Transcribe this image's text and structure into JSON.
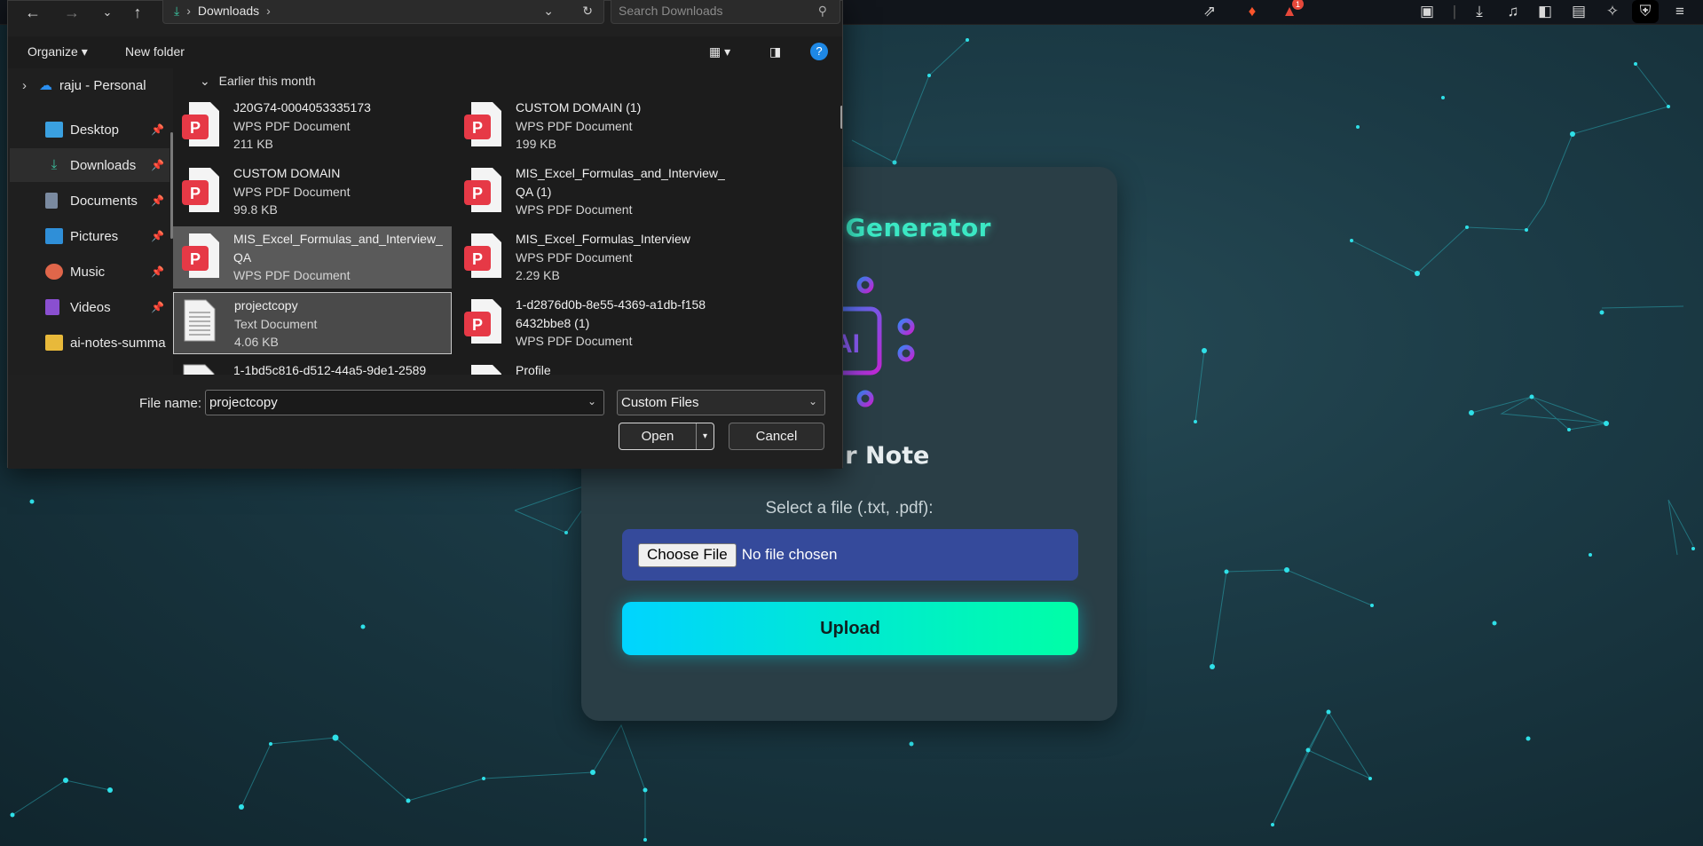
{
  "colors": {
    "accent_teal": "#3be8c4",
    "file_input_bg": "#354a9b",
    "upload_gradient_start": "#00d4ff",
    "upload_gradient_end": "#00ffa6",
    "card_bg": "#2a3e46",
    "pdf_red": "#e63946"
  },
  "webpage": {
    "title": "...mmary Generator",
    "logo_text": "AI",
    "subtitle": "...Your Note",
    "select_label": "Select a file (.txt, .pdf):",
    "choose_file_label": "Choose File",
    "no_file_text": "No file chosen",
    "upload_label": "Upload"
  },
  "browser_toolbar": {
    "notification_count": "1",
    "icons": [
      "share-icon",
      "brave-lion-icon",
      "rewards-triangle-icon",
      "screenshot-icon",
      "download-icon",
      "music-icon",
      "sidebar-icon",
      "wallet-icon",
      "leo-ai-icon",
      "vpn-shield-icon",
      "menu-icon"
    ]
  },
  "dialog": {
    "address_path": "Downloads",
    "search_placeholder": "Search Downloads",
    "toolbar": {
      "organize": "Organize",
      "new_folder": "New folder"
    },
    "nav": {
      "cloud": "raju - Personal",
      "items": [
        {
          "label": "Desktop",
          "icon": "desktop-icon"
        },
        {
          "label": "Downloads",
          "icon": "download-icon"
        },
        {
          "label": "Documents",
          "icon": "documents-icon"
        },
        {
          "label": "Pictures",
          "icon": "pictures-icon"
        },
        {
          "label": "Music",
          "icon": "music-icon"
        },
        {
          "label": "Videos",
          "icon": "videos-icon"
        },
        {
          "label": "ai-notes-summa",
          "icon": "folder-icon"
        }
      ]
    },
    "group_header": "Earlier this month",
    "files": [
      {
        "name": "J20G74-0004053335173",
        "type": "WPS PDF Document",
        "size": "211 KB"
      },
      {
        "name": "CUSTOM DOMAIN (1)",
        "type": "WPS PDF Document",
        "size": "199 KB"
      },
      {
        "name": "CUSTOM DOMAIN",
        "type": "WPS PDF Document",
        "size": "99.8 KB"
      },
      {
        "name": "MIS_Excel_Formulas_and_Interview_",
        "name2": "QA (1)",
        "type": "WPS PDF Document"
      },
      {
        "name": "MIS_Excel_Formulas_and_Interview_",
        "name2": "QA",
        "type": "WPS PDF Document"
      },
      {
        "name": "MIS_Excel_Formulas_Interview",
        "type": "WPS PDF Document",
        "size": "2.29 KB"
      },
      {
        "name": "projectcopy",
        "type": "Text Document",
        "size": "4.06 KB"
      },
      {
        "name": "1-d2876d0b-8e55-4369-a1db-f158",
        "name2": "6432bbe8 (1)",
        "type": "WPS PDF Document"
      },
      {
        "name": "1-1bd5c816-d512-44a5-9de1-2589"
      },
      {
        "name": "Profile"
      }
    ],
    "file_name_label": "File name:",
    "file_name_value": "projectcopy",
    "file_type_value": "Custom Files",
    "open_label": "Open",
    "cancel_label": "Cancel"
  }
}
